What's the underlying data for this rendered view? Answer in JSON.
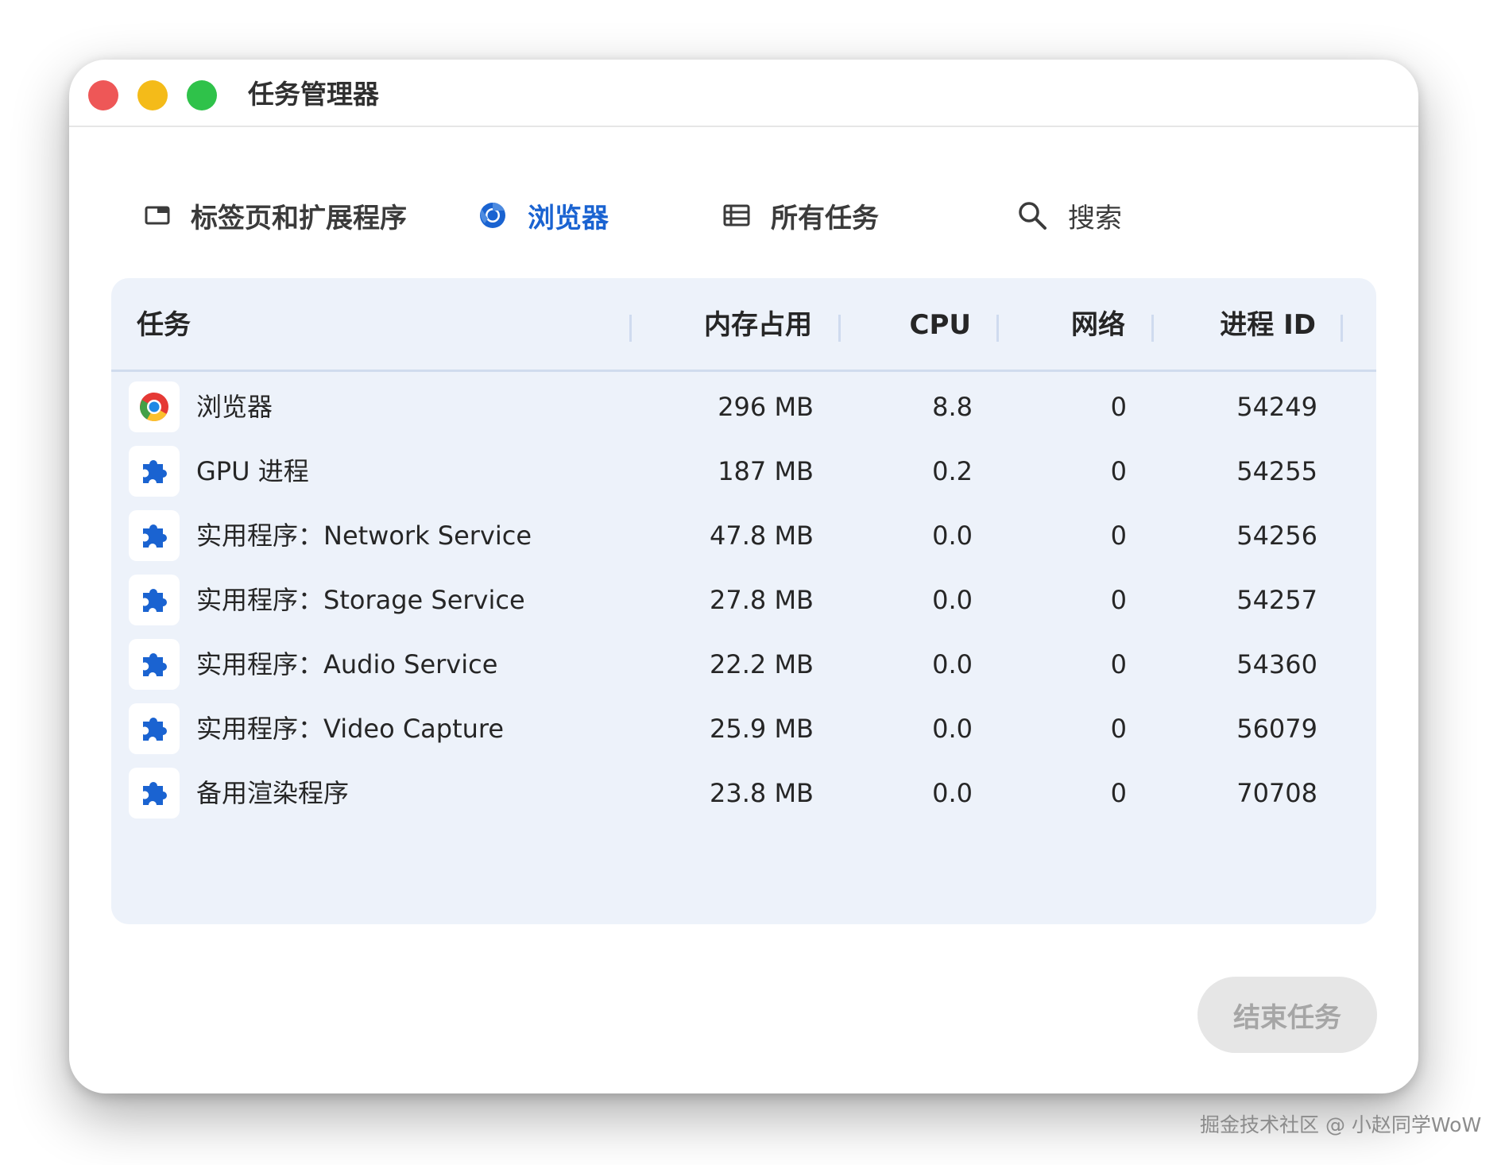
{
  "window": {
    "title": "任务管理器"
  },
  "tabs": [
    {
      "label": "标签页和扩展程序",
      "icon": "tab-icon"
    },
    {
      "label": "浏览器",
      "icon": "chrome-icon",
      "active": true
    },
    {
      "label": "所有任务",
      "icon": "list-icon"
    },
    {
      "label": "搜索",
      "icon": "search-icon"
    }
  ],
  "table": {
    "headers": {
      "task": "任务",
      "memory": "内存占用",
      "cpu": "CPU",
      "network": "网络",
      "pid": "进程 ID"
    },
    "rows": [
      {
        "icon": "chrome-icon",
        "task": "浏览器",
        "memory": "296 MB",
        "cpu": "8.8",
        "network": "0",
        "pid": "54249"
      },
      {
        "icon": "puzzle-icon",
        "task": "GPU 进程",
        "memory": "187 MB",
        "cpu": "0.2",
        "network": "0",
        "pid": "54255"
      },
      {
        "icon": "puzzle-icon",
        "task": "实用程序：Network Service",
        "memory": "47.8 MB",
        "cpu": "0.0",
        "network": "0",
        "pid": "54256"
      },
      {
        "icon": "puzzle-icon",
        "task": "实用程序：Storage Service",
        "memory": "27.8 MB",
        "cpu": "0.0",
        "network": "0",
        "pid": "54257"
      },
      {
        "icon": "puzzle-icon",
        "task": "实用程序：Audio Service",
        "memory": "22.2 MB",
        "cpu": "0.0",
        "network": "0",
        "pid": "54360"
      },
      {
        "icon": "puzzle-icon",
        "task": "实用程序：Video Capture",
        "memory": "25.9 MB",
        "cpu": "0.0",
        "network": "0",
        "pid": "56079"
      },
      {
        "icon": "puzzle-icon",
        "task": "备用渲染程序",
        "memory": "23.8 MB",
        "cpu": "0.0",
        "network": "0",
        "pid": "70708"
      }
    ]
  },
  "footer": {
    "end_task_label": "结束任务"
  },
  "watermark": "掘金技术社区 @ 小赵同学WoW",
  "colors": {
    "accent": "#1a63d1",
    "panel": "#edf2fa",
    "close": "#ee5757",
    "minimize": "#f4bb19",
    "maximize": "#2fc24a"
  }
}
